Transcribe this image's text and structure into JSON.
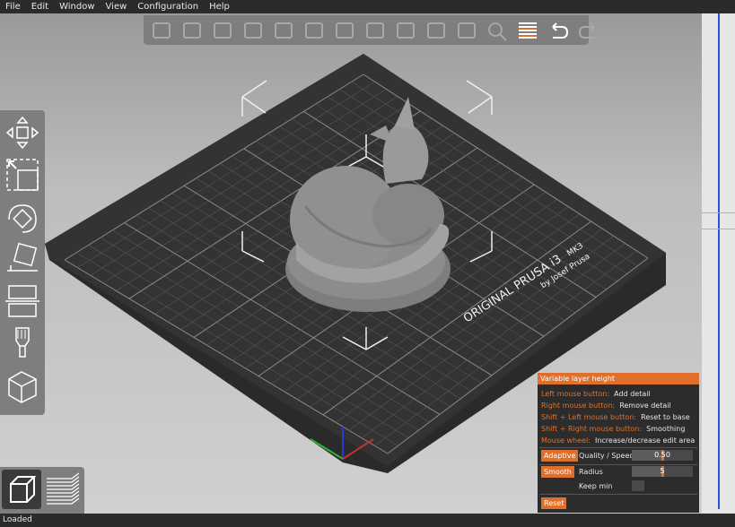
{
  "menu": [
    "File",
    "Edit",
    "Window",
    "View",
    "Configuration",
    "Help"
  ],
  "toolbar_icons": [
    "add-icon",
    "delete-icon",
    "delete-all-icon",
    "arrange-icon",
    "copy-icon",
    "paste-icon",
    "add-instance-icon",
    "remove-instance-icon",
    "split-objects-icon",
    "split-parts-icon",
    "layers-editing-icon",
    "search-icon",
    "variable-layer-height-icon",
    "undo-icon",
    "redo-icon"
  ],
  "left_tools": [
    "move-icon",
    "scale-icon",
    "rotate-icon",
    "place-on-face-icon",
    "cut-icon",
    "support-painting-icon",
    "seam-painting-icon"
  ],
  "bed": {
    "brand": "ORIGINAL PRUSA i3",
    "model": "MK3",
    "maker": "by Josef Prusa"
  },
  "vlh": {
    "title": "Variable layer height",
    "lines": [
      {
        "key": "Left mouse button:",
        "desc": "Add detail"
      },
      {
        "key": "Right mouse button:",
        "desc": "Remove detail"
      },
      {
        "key": "Shift + Left mouse button:",
        "desc": "Reset to base"
      },
      {
        "key": "Shift + Right mouse button:",
        "desc": "Smoothing"
      },
      {
        "key": "Mouse wheel:",
        "desc": "Increase/decrease edit area"
      }
    ],
    "adaptive_label": "Adaptive",
    "quality_label": "Quality / Speed",
    "quality_value": "0.50",
    "quality_level": 0.5,
    "smooth_label": "Smooth",
    "radius_label": "Radius",
    "radius_value": "5",
    "radius_level": 0.5,
    "keepmin_label": "Keep min",
    "reset_label": "Reset"
  },
  "status": "Loaded",
  "colors": {
    "accent": "#e06f2b",
    "bed": "#2a2a2a",
    "grid": "#6a6a6a",
    "model": "#8c8c8c",
    "menubar": "#2b2b2b"
  }
}
